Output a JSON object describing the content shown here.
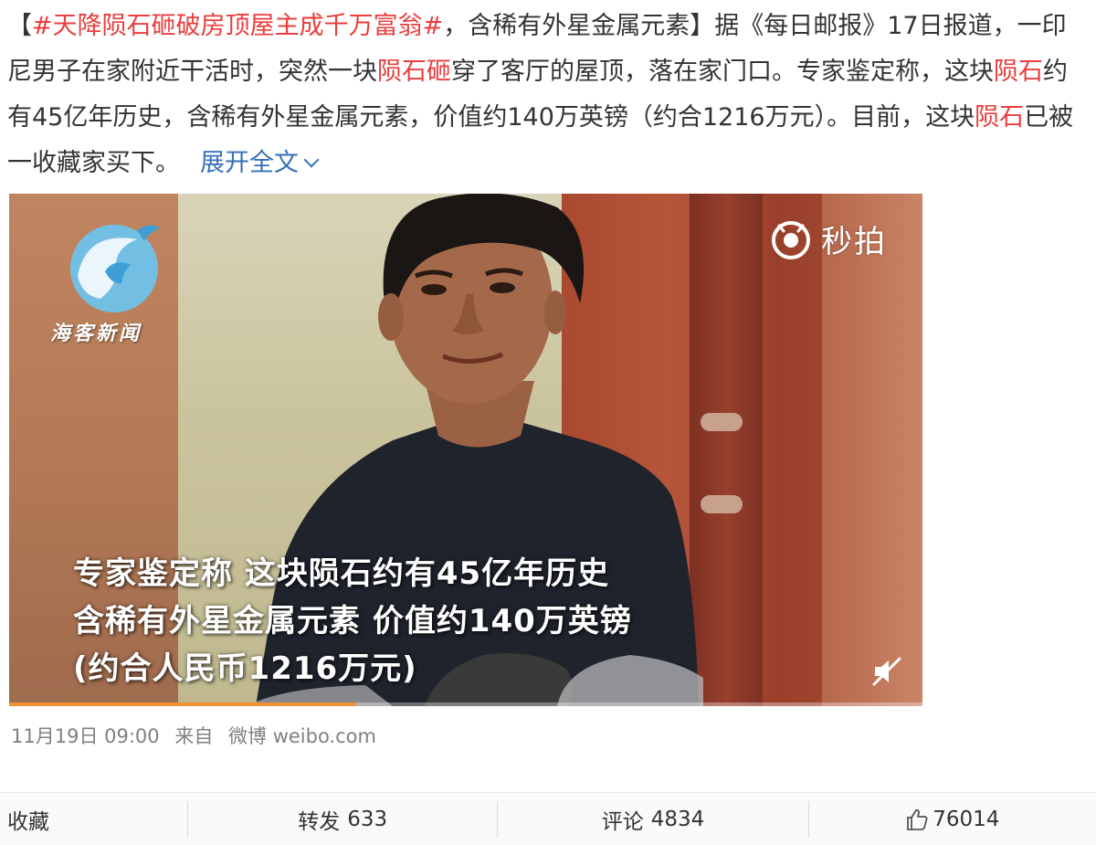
{
  "post": {
    "open_bracket": "【",
    "hashtag": "#天降陨石砸破房顶屋主成千万富翁#",
    "seg1": "，含稀有外星金属元素】据《每日邮报》17日报道，一印尼男子在家附近干活时，突然一块",
    "kw1": "陨石砸",
    "seg2": "穿了客厅的屋顶，落在家门口。专家鉴定称，这块",
    "kw2": "陨石",
    "seg3": "约有45亿年历史，含稀有外星金属元素，价值约140万英镑（约合1216万元）。目前，这块",
    "kw3": "陨石",
    "seg4": "已被一收藏家买下。",
    "expand_label": "展开全文"
  },
  "video": {
    "logo_text": "海客新闻",
    "watermark": "秒拍",
    "subtitle_line1": "专家鉴定称 这块陨石约有45亿年历史",
    "subtitle_line2": "含稀有外星金属元素 价值约140万英镑",
    "subtitle_line3": "(约合人民币1216万元)",
    "progress": 0.38
  },
  "meta": {
    "time": "11月19日 09:00",
    "from_label": "来自",
    "source": "微博 weibo.com"
  },
  "actions": {
    "favorite": "收藏",
    "repost_label": "转发",
    "repost_count": "633",
    "comment_label": "评论",
    "comment_count": "4834",
    "like_count": "76014"
  },
  "icons": [
    "miaopai-logo-icon",
    "mute-icon",
    "thumbs-up-icon",
    "haike-logo-icon"
  ],
  "colors": {
    "hashtag": "#eb3d3d",
    "link": "#3670b8",
    "meta": "#808080",
    "progress": "#f19131"
  }
}
